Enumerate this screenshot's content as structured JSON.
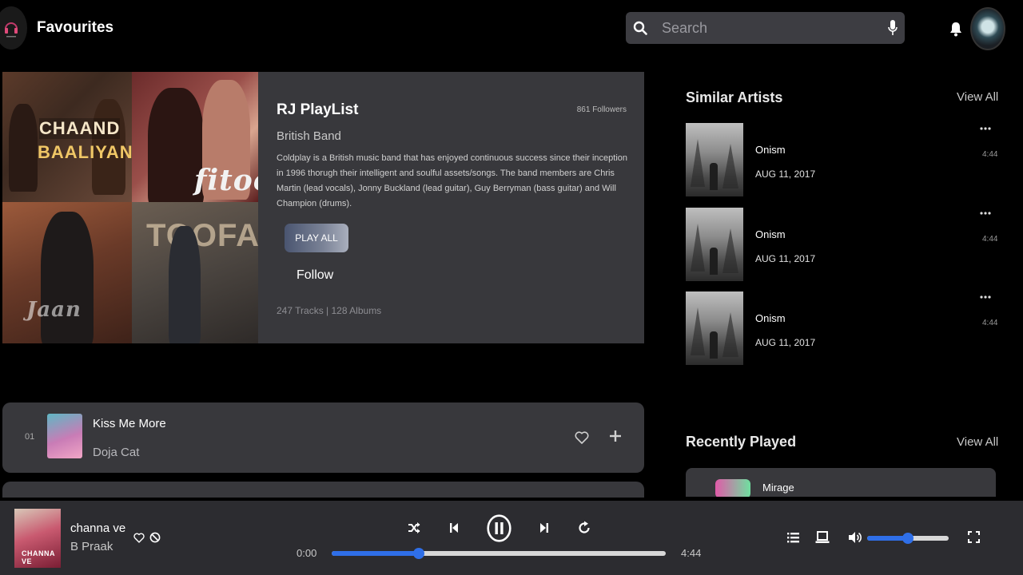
{
  "header": {
    "title": "Favourites",
    "search_placeholder": "Search"
  },
  "playlist": {
    "title": "RJ PlayList",
    "followers": "861 Followers",
    "subtitle": "British Band",
    "description": "Coldplay is a British music band that has enjoyed continuous success since their inception in 1996 thorugh their intelligent and soulful assets/songs. The band members are Chris Martin (lead vocals), Jonny Buckland (lead guitar), Guy Berryman (bass guitar) and Will Champion (drums).",
    "play_all_label": "PLAY ALL",
    "follow_label": "Follow",
    "stats": "247 Tracks | 128 Albums",
    "covers": [
      {
        "line1": "CHAAND",
        "line2": "BAALIYAN"
      },
      {
        "line1": "fitoor"
      },
      {
        "line1": "Jaan"
      },
      {
        "line1": "TOOFAN"
      }
    ]
  },
  "tracks": [
    {
      "number": "01",
      "title": "Kiss Me More",
      "artist": "Doja Cat"
    }
  ],
  "similar_artists": {
    "title": "Similar Artists",
    "view_all": "View All",
    "items": [
      {
        "name": "Onism",
        "date": "AUG 11, 2017",
        "duration": "4:44"
      },
      {
        "name": "Onism",
        "date": "AUG 11, 2017",
        "duration": "4:44"
      },
      {
        "name": "Onism",
        "date": "AUG 11, 2017",
        "duration": "4:44"
      }
    ]
  },
  "recently_played": {
    "title": "Recently Played",
    "view_all": "View All",
    "items": [
      {
        "title": "Mirage"
      }
    ]
  },
  "player": {
    "title": "channa ve",
    "artist": "B Praak",
    "cover_label": "CHANNA VE",
    "current_time": "0:00",
    "total_time": "4:44",
    "progress": 0.26,
    "volume": 0.5
  },
  "colors": {
    "accent": "#2f6fe8",
    "card_bg": "#38383c",
    "player_bg": "#2c2c30"
  }
}
